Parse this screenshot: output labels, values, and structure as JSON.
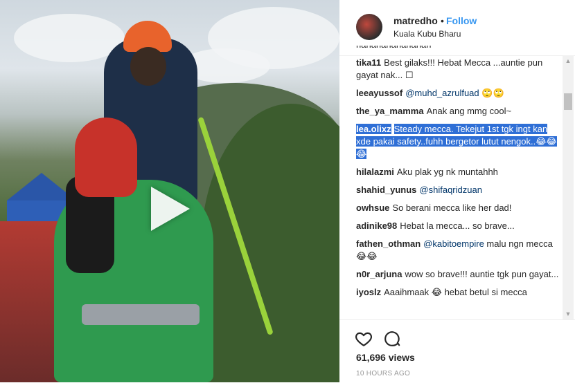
{
  "post": {
    "username": "matredho",
    "separator": "•",
    "follow_label": "Follow",
    "location": "Kuala Kubu Bharu",
    "views": "61,696 views",
    "time": "10 HOURS AGO"
  },
  "comments": [
    {
      "user": "",
      "text": "hahahahahahahah"
    },
    {
      "user": "tika11",
      "text": "Best gilaks!!! Hebat Mecca ...auntie pun gayat nak... ☐"
    },
    {
      "user": "leeayussof",
      "mention": "@muhd_azrulfuad",
      "text": "🙄🙄"
    },
    {
      "user": "the_ya_mamma",
      "text": "Anak ang mmg cool~"
    },
    {
      "user": "lea.olixz",
      "text": "Steady mecca. Tekejut 1st tgk ingt kan xde pakai safety..fuhh bergetor lutut nengok..😂😂😂"
    },
    {
      "user": "hilalazmi",
      "text": "Aku plak yg nk muntahhh"
    },
    {
      "user": "shahid_yunus",
      "mention": "@shifaqridzuan",
      "text": ""
    },
    {
      "user": "owhsue",
      "text": "So berani mecca like her dad!"
    },
    {
      "user": "adinike98",
      "text": "Hebat la mecca... so brave..."
    },
    {
      "user": "fathen_othman",
      "mention": "@kabitoempire",
      "text": "malu ngn mecca 😂😂"
    },
    {
      "user": "n0r_arjuna",
      "text": "wow so brave!!! auntie tgk pun gayat..."
    },
    {
      "user": "iyoslz",
      "text": "Aaaihmaak 😂 hebat betul si mecca"
    }
  ],
  "icons": {
    "play": "play-icon",
    "like": "heart-icon",
    "comment": "comment-icon"
  },
  "colors": {
    "follow": "#3897f0",
    "highlight": "#2f6fd6",
    "helmet": "#e8632c",
    "shirt": "#2f9a4f"
  }
}
